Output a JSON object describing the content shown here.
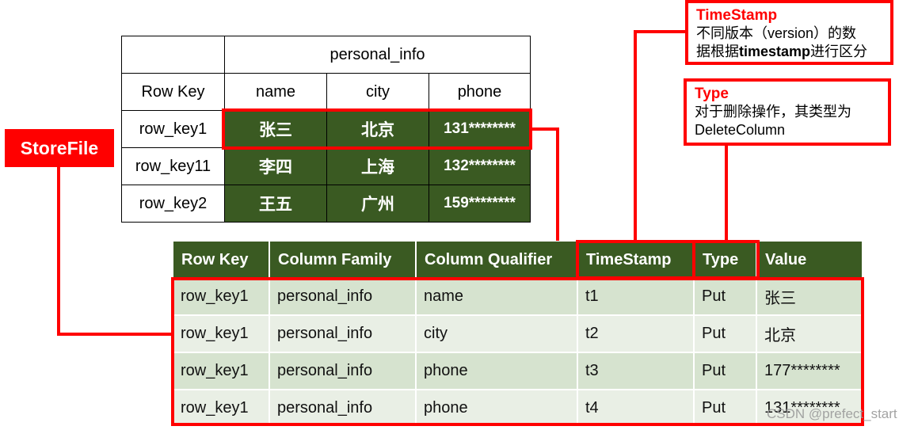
{
  "logical_table": {
    "column_family": "personal_info",
    "headers": [
      "Row Key",
      "name",
      "city",
      "phone"
    ],
    "rows": [
      {
        "row_key": "row_key1",
        "name": "张三",
        "city": "北京",
        "phone": "131********"
      },
      {
        "row_key": "row_key11",
        "name": "李四",
        "city": "上海",
        "phone": "132********"
      },
      {
        "row_key": "row_key2",
        "name": "王五",
        "city": "广州",
        "phone": "159********"
      }
    ]
  },
  "storefile_label": "StoreFile",
  "storefile_table": {
    "headers": [
      "Row Key",
      "Column Family",
      "Column Qualifier",
      "TimeStamp",
      "Type",
      "Value"
    ],
    "rows": [
      [
        "row_key1",
        "personal_info",
        "name",
        "t1",
        "Put",
        "张三"
      ],
      [
        "row_key1",
        "personal_info",
        "city",
        "t2",
        "Put",
        "北京"
      ],
      [
        "row_key1",
        "personal_info",
        "phone",
        "t3",
        "Put",
        "177********"
      ],
      [
        "row_key1",
        "personal_info",
        "phone",
        "t4",
        "Put",
        "131********"
      ]
    ]
  },
  "callouts": {
    "timestamp": {
      "title": "TimeStamp",
      "line1": "不同版本（version）的数",
      "line2_pre": "据根据",
      "line2_bold": "timestamp",
      "line2_post": "进行区分"
    },
    "type": {
      "title": "Type",
      "line1": "对于删除操作，其类型为",
      "line2": "DeleteColumn"
    }
  },
  "watermark": "CSDN @prefect_start",
  "colors": {
    "accent_red": "#ff0000",
    "header_green": "#3a5a22",
    "row_light_a": "#d6e3cf",
    "row_light_b": "#e9efe5"
  }
}
